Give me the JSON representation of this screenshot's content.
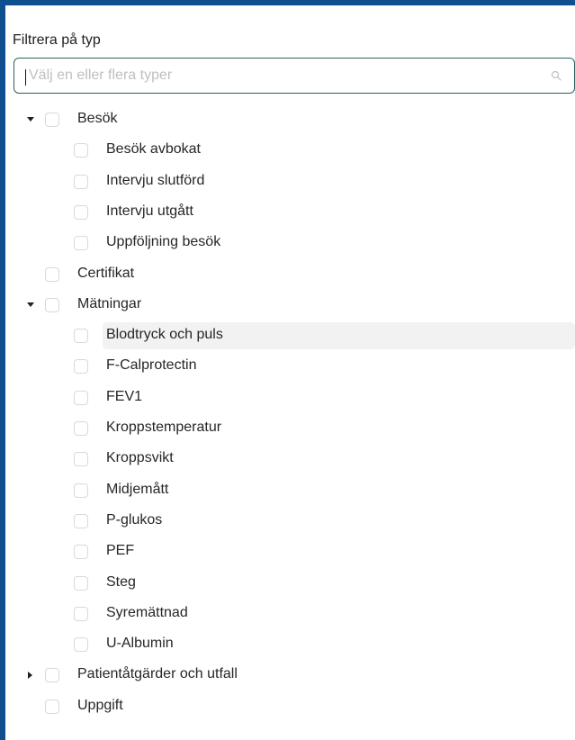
{
  "filter": {
    "label": "Filtrera på typ",
    "search_placeholder": "Välj en eller flera typer",
    "search_value": ""
  },
  "tree": {
    "items": [
      {
        "label": "Besök",
        "level": 0,
        "arrow": "expanded"
      },
      {
        "label": "Besök avbokat",
        "level": 1
      },
      {
        "label": "Intervju slutförd",
        "level": 1
      },
      {
        "label": "Intervju utgått",
        "level": 1
      },
      {
        "label": "Uppföljning besök",
        "level": 1
      },
      {
        "label": "Certifikat",
        "level": 0
      },
      {
        "label": "Mätningar",
        "level": 0,
        "arrow": "expanded"
      },
      {
        "label": "Blodtryck och puls",
        "level": 1,
        "highlighted": true
      },
      {
        "label": "F-Calprotectin",
        "level": 1
      },
      {
        "label": "FEV1",
        "level": 1
      },
      {
        "label": "Kroppstemperatur",
        "level": 1
      },
      {
        "label": "Kroppsvikt",
        "level": 1
      },
      {
        "label": "Midjemått",
        "level": 1
      },
      {
        "label": "P-glukos",
        "level": 1
      },
      {
        "label": "PEF",
        "level": 1
      },
      {
        "label": "Steg",
        "level": 1
      },
      {
        "label": "Syremättnad",
        "level": 1
      },
      {
        "label": "U-Albumin",
        "level": 1
      },
      {
        "label": "Patientåtgärder och utfall",
        "level": 0,
        "arrow": "collapsed"
      },
      {
        "label": "Uppgift",
        "level": 0
      }
    ]
  },
  "colors": {
    "frame": "#0f4f8f",
    "search_border": "#2f5f5f",
    "highlight": "#f2f2f2",
    "checkbox_border": "#d9d9d9"
  },
  "icons": {
    "search": "search-icon",
    "expanded": "caret-down-icon",
    "collapsed": "caret-right-icon"
  }
}
